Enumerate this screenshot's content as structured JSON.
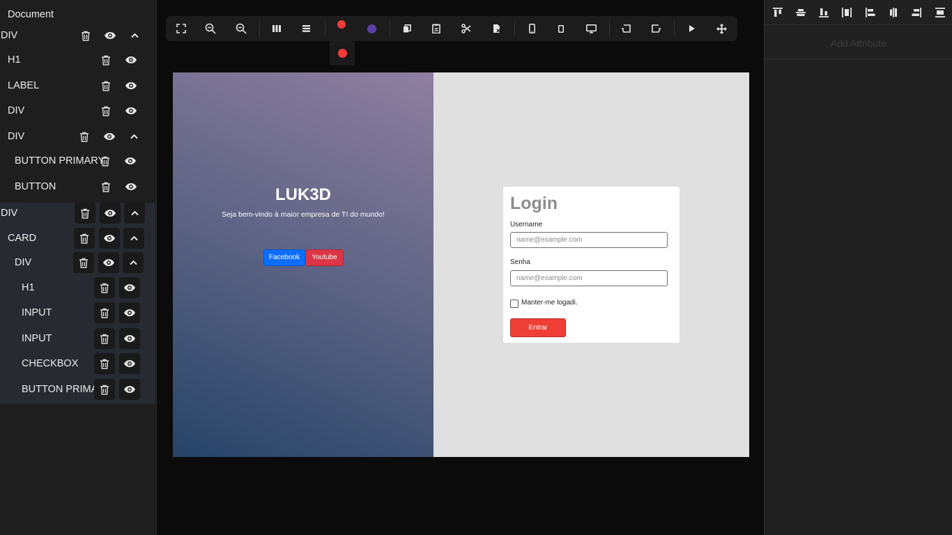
{
  "layers": {
    "title": "Document",
    "rows": [
      {
        "label": "DIV",
        "collapse": true
      },
      {
        "label": "H1"
      },
      {
        "label": "LABEL"
      },
      {
        "label": "DIV"
      },
      {
        "label": "DIV",
        "collapse": true
      },
      {
        "label": "BUTTON PRIMARY"
      },
      {
        "label": "BUTTON"
      },
      {
        "label": "DIV",
        "collapse": true
      },
      {
        "label": "CARD",
        "collapse": true
      },
      {
        "label": "DIV",
        "collapse": true
      },
      {
        "label": "H1"
      },
      {
        "label": "INPUT"
      },
      {
        "label": "INPUT"
      },
      {
        "label": "CHECKBOX"
      },
      {
        "label": "BUTTON PRIMARY"
      }
    ]
  },
  "toolbar": {
    "icons": [
      "fullscreen-icon",
      "zoom-out-icon",
      "zoom-out-icon",
      "columns-icon",
      "rows-icon",
      "red-color-icon",
      "purple-color-icon",
      "copy-icon",
      "paste-icon",
      "cut-icon",
      "delete-file-icon",
      "mobile-icon",
      "tablet-icon",
      "desktop-icon",
      "undo-icon",
      "redo-icon",
      "play-icon",
      "move-icon"
    ],
    "colors": {
      "red": "#f23b3b",
      "purple": "#5b3fa6"
    }
  },
  "canvas": {
    "brand": "LUK3D",
    "tagline": "Seja bem-vindo à maior empresa de TI do mundo!",
    "facebook_label": "Facebook",
    "youtube_label": "Youtube",
    "facebook_color": "#0d6efd",
    "youtube_color": "#dc3545",
    "card": {
      "title": "Login",
      "username_label": "Username",
      "username_placeholder": "name@example.com",
      "password_label": "Senha",
      "password_placeholder": "name@example.com",
      "remember_label": "Manter-me logadi.",
      "submit_label": "Entrar"
    }
  },
  "attributes": {
    "title": "Add Attribute",
    "align_icons": [
      "align-top-icon",
      "align-vertical-center-icon",
      "align-bottom-icon",
      "distribute-vertical-icon",
      "align-left-icon",
      "align-horizontal-center-icon",
      "align-right-icon",
      "distribute-horizontal-icon"
    ]
  }
}
